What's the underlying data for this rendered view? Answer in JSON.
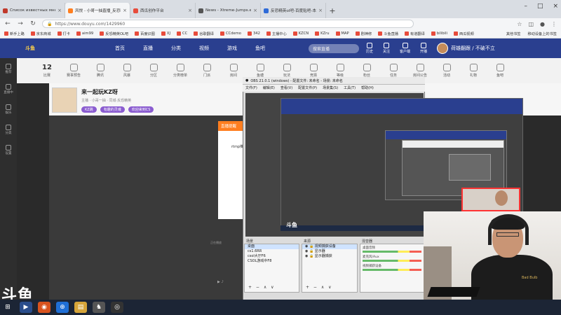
{
  "tabs": [
    {
      "title": "Список известных мне карт",
      "color": "#c0392b"
    },
    {
      "title": "风悦 - 小哥一抽直播_反恐精英",
      "color": "#ff7e1f"
    },
    {
      "title": "西瓜创作平台",
      "color": "#e74c3c"
    },
    {
      "title": "News - Xtreme-Jumps.eu",
      "color": "#555555"
    },
    {
      "title": "反恐精英ol吧-百度贴吧-本吧",
      "color": "#2f6bd8"
    }
  ],
  "active_tab": 1,
  "url": "https://www.douyu.com/1429960",
  "bookmarks": [
    "新手上路",
    "京东商城",
    "打卡",
    "aim99",
    "反恐精英OL吧",
    "百度识图",
    "XJ",
    "CC",
    "谷歌翻译",
    "CCdemo",
    "342",
    "主播中心",
    "KZCN",
    "KZru",
    "MAP",
    "剧神修",
    "斗鱼直播",
    "有道翻译",
    "bilibili",
    "西瓜视频"
  ],
  "bookmarks_right": [
    "其他书签",
    "移动设备上的书签"
  ],
  "douyu": {
    "nav": [
      "首页",
      "直播",
      "分类",
      "视频",
      "游戏",
      "鱼吧"
    ],
    "search_placeholder": "搜索直播",
    "top_icons": [
      "历史",
      "关注",
      "客户端",
      "开播"
    ],
    "user_text": "荷雄翻跟 / 不破不立",
    "accent": "#2a3f8f",
    "sidebar": [
      "推荐",
      "直播中",
      "娱乐",
      "分类",
      "设置"
    ],
    "categories": [
      "比赛",
      "赛事预告",
      "腾讯",
      "风暴",
      "分区",
      "分类榜单",
      "门派",
      "房间",
      "鱼塘",
      "玩法",
      "竞猜",
      "等级",
      "粉丝",
      "任务",
      "房间公告",
      "活动",
      "礼物",
      "鱼吧"
    ],
    "cat_num": "12",
    "room_title": "来一起玩KZ呀",
    "room_meta": "主播 · 小哥一抽 · 同城·反恐精英",
    "room_tags": [
      "KZ跳",
      "有趣的灵魂",
      "欢迎来到CS"
    ],
    "popup_head": "直播提醒",
    "popup_text": "rtmp推流中...",
    "player_label": "正在播放"
  },
  "obs": {
    "title": "OBS 21.0.1 (windows) - 配置文件: 未命名 - 场景: 未命名",
    "menu": [
      "文件(F)",
      "编辑(E)",
      "查看(V)",
      "配置文件(P)",
      "场景集(S)",
      "工具(T)",
      "帮助(H)"
    ],
    "scenes_header": "场景",
    "scenes": [
      "桌面",
      "cs1.6RR",
      "csol大厅F6",
      "CSOL游戏中F8"
    ],
    "sources_header": "来源",
    "sources": [
      "视频捕获设备",
      "显示器",
      "显示器捕获"
    ],
    "mixer_header": "混音器",
    "mixer": [
      "桌面音频",
      "麦克风/Aux",
      "视频捕获设备"
    ],
    "controls": "+ − ∧ ∨"
  },
  "watermark": "斗鱼",
  "shirt_text": "Bad Bulb"
}
